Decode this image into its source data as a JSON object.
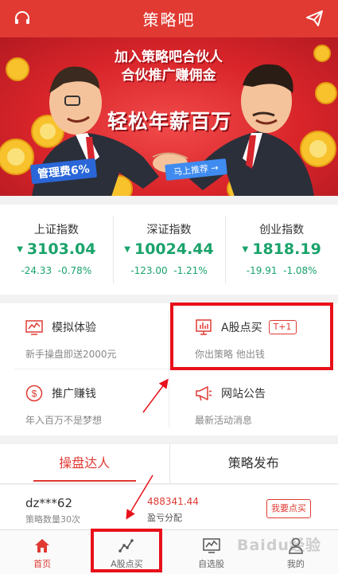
{
  "header": {
    "title": "策略吧",
    "left_icon": "headset-icon",
    "right_icon": "paper-plane-icon"
  },
  "banner": {
    "headline_line1": "加入策略吧合伙人",
    "headline_line2": "合伙推广赚佣金",
    "big_text": "轻松年薪百万",
    "fee_badge": "管理费6%",
    "recommend_button": "马上推荐 →"
  },
  "indices": [
    {
      "name": "上证指数",
      "value": "3103.04",
      "change": "-24.33",
      "percent": "-0.78%",
      "direction": "down"
    },
    {
      "name": "深证指数",
      "value": "10024.44",
      "change": "-123.00",
      "percent": "-1.21%",
      "direction": "down"
    },
    {
      "name": "创业指数",
      "value": "1818.19",
      "change": "-19.91",
      "percent": "-1.08%",
      "direction": "down"
    }
  ],
  "features": [
    {
      "title": "模拟体验",
      "subtitle": "新手操盘即送2000元",
      "icon": "chart-monitor-icon"
    },
    {
      "title": "A股点买",
      "subtitle": "你出策略 他出钱",
      "tag": "T+1",
      "icon": "bar-chart-icon"
    },
    {
      "title": "推广赚钱",
      "subtitle": "年入百万不是梦想",
      "icon": "dollar-coin-icon"
    },
    {
      "title": "网站公告",
      "subtitle": "最新活动消息",
      "icon": "megaphone-icon"
    }
  ],
  "tabs": [
    {
      "label": "操盘达人",
      "active": true
    },
    {
      "label": "策略发布",
      "active": false
    }
  ],
  "trader": {
    "username": "dz***62",
    "count_text": "策略数量30次",
    "amount": "488341.44",
    "split_label": "盈亏分配",
    "button_label": "我要点买"
  },
  "bottom_nav": [
    {
      "label": "首页",
      "icon": "home-icon",
      "active": true
    },
    {
      "label": "A股点买",
      "icon": "trend-line-icon",
      "active": false
    },
    {
      "label": "自选股",
      "icon": "stock-monitor-icon",
      "active": false
    },
    {
      "label": "我的",
      "icon": "user-icon",
      "active": false
    }
  ],
  "watermark": "Baidu经验",
  "colors": {
    "brand_red": "#e03a33",
    "down_green": "#1aa36b",
    "annotation_red": "#e8101a"
  }
}
